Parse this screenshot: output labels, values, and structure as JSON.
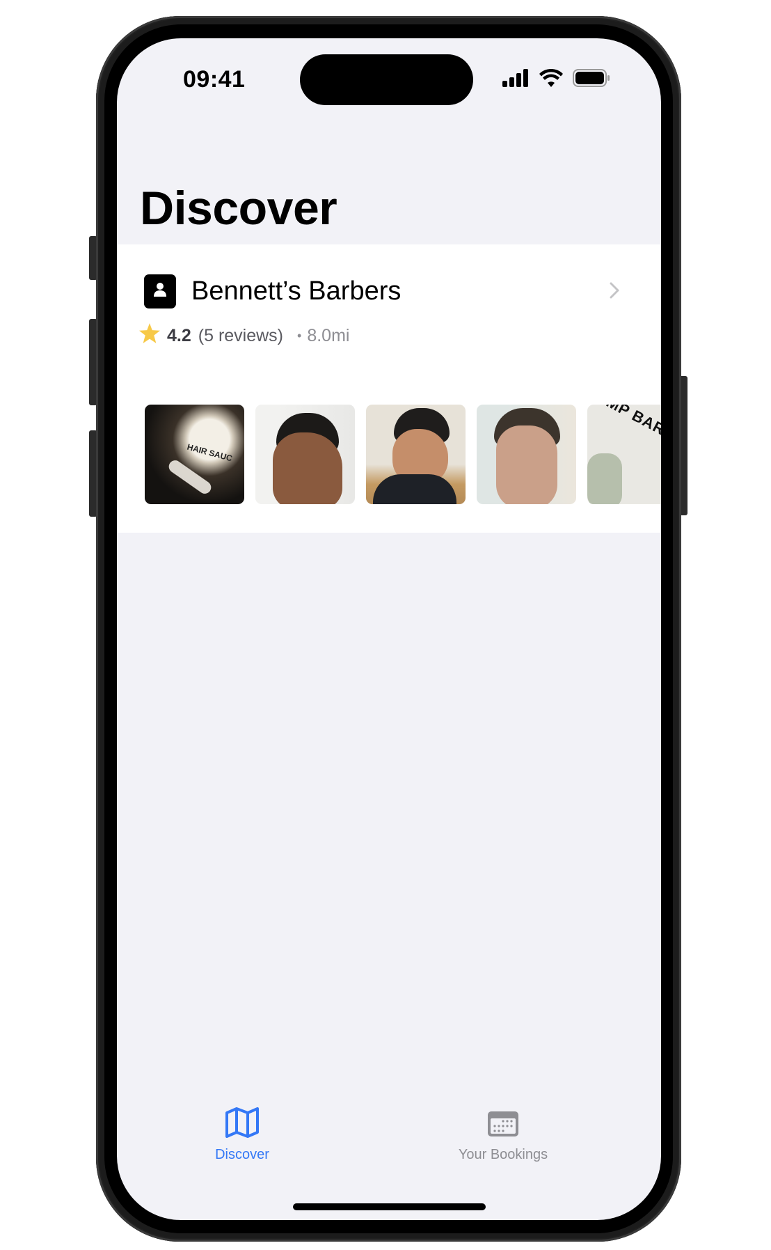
{
  "status_bar": {
    "time": "09:41",
    "icons": [
      "cellular-signal-icon",
      "wifi-icon",
      "battery-icon"
    ]
  },
  "page": {
    "title": "Discover"
  },
  "listing": {
    "name": "Bennett’s Barbers",
    "avatar_icon": "person-icon",
    "rating": "4.2",
    "reviews": "(5 reviews)",
    "separator": "•",
    "distance": "8.0mi",
    "star_color": "#f7c948",
    "photos": [
      {
        "description": "Hair sauce pomade jar",
        "overlay_text": "HAIR SAUC"
      },
      {
        "description": "Man with short fade haircut, side profile"
      },
      {
        "description": "Man with textured quiff fade in barbershop"
      },
      {
        "description": "Man with short textured haircut"
      },
      {
        "description": "Barbershop logo wall with plant",
        "overlay_text": "EMP BARBERS"
      }
    ]
  },
  "tabbar": {
    "tabs": [
      {
        "label": "Discover",
        "icon": "map-icon",
        "active": true,
        "color": "#3478f6"
      },
      {
        "label": "Your Bookings",
        "icon": "calendar-icon",
        "active": false,
        "color": "#8e8e93"
      }
    ]
  }
}
